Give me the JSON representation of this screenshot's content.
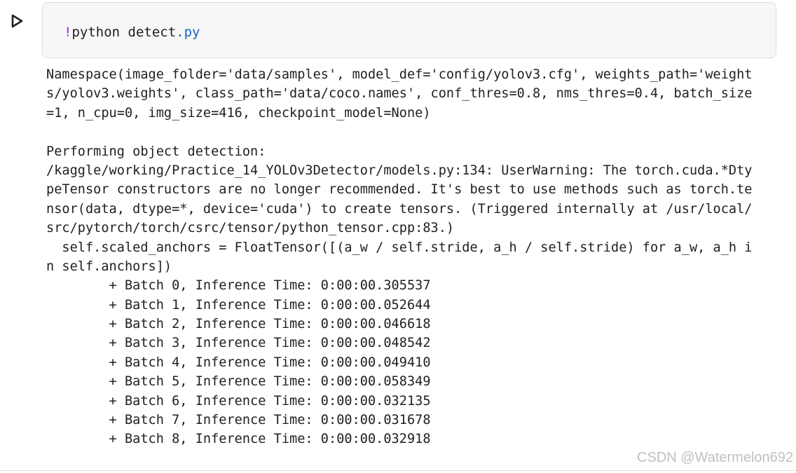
{
  "cell": {
    "run_icon": "play-icon",
    "code": {
      "bang": "!",
      "command": "python detect",
      "ext": ".py"
    }
  },
  "output": {
    "lines": [
      "Namespace(image_folder='data/samples', model_def='config/yolov3.cfg', weights_path='weight",
      "s/yolov3.weights', class_path='data/coco.names', conf_thres=0.8, nms_thres=0.4, batch_size",
      "=1, n_cpu=0, img_size=416, checkpoint_model=None)",
      "",
      "Performing object detection:",
      "/kaggle/working/Practice_14_YOLOv3Detector/models.py:134: UserWarning: The torch.cuda.*Dty",
      "peTensor constructors are no longer recommended. It's best to use methods such as torch.te",
      "nsor(data, dtype=*, device='cuda') to create tensors. (Triggered internally at /usr/local/",
      "src/pytorch/torch/csrc/tensor/python_tensor.cpp:83.)",
      "  self.scaled_anchors = FloatTensor([(a_w / self.stride, a_h / self.stride) for a_w, a_h i",
      "n self.anchors])",
      "        + Batch 0, Inference Time: 0:00:00.305537",
      "        + Batch 1, Inference Time: 0:00:00.052644",
      "        + Batch 2, Inference Time: 0:00:00.046618",
      "        + Batch 3, Inference Time: 0:00:00.048542",
      "        + Batch 4, Inference Time: 0:00:00.049410",
      "        + Batch 5, Inference Time: 0:00:00.058349",
      "        + Batch 6, Inference Time: 0:00:00.032135",
      "        + Batch 7, Inference Time: 0:00:00.031678",
      "        + Batch 8, Inference Time: 0:00:00.032918"
    ]
  },
  "watermark": "CSDN @Watermelon692",
  "colors": {
    "bang": "#a020f0",
    "ext": "#1565c0",
    "cell_bg": "#f7f7f7",
    "text": "#1f1f1f"
  }
}
